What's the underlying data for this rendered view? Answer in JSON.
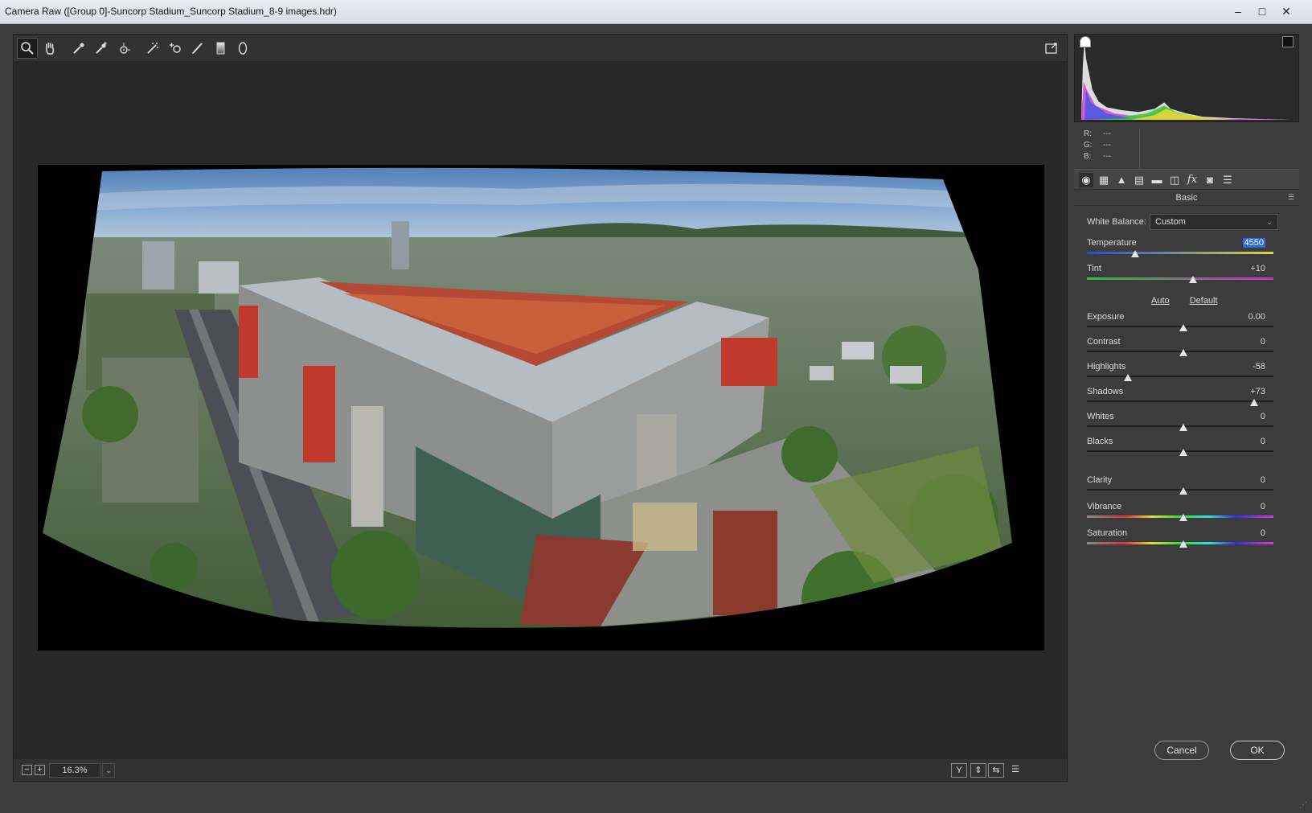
{
  "window": {
    "title": "Camera Raw ([Group 0]-Suncorp Stadium_Suncorp Stadium_8-9 images.hdr)",
    "minimize": "–",
    "maximize": "□",
    "close": "✕"
  },
  "toolbar": {
    "tools": [
      {
        "name": "zoom-tool",
        "icon": "magnifier"
      },
      {
        "name": "hand-tool",
        "icon": "hand"
      },
      {
        "name": "white-balance-tool",
        "icon": "eyedropper"
      },
      {
        "name": "color-sampler-tool",
        "icon": "eyedropper-plus"
      },
      {
        "name": "targeted-adjustment-tool",
        "icon": "target"
      },
      {
        "name": "straighten-tool",
        "icon": "spot"
      },
      {
        "name": "spot-removal-tool",
        "icon": "heal"
      },
      {
        "name": "adjustment-brush-tool",
        "icon": "brush"
      },
      {
        "name": "graduated-filter-tool",
        "icon": "gradient"
      },
      {
        "name": "radial-filter-tool",
        "icon": "ellipse"
      }
    ],
    "fullscreen_icon": "fullscreen"
  },
  "canvas": {
    "zoom": "16.3%",
    "zoom_out": "−",
    "zoom_in": "+",
    "zoom_caret": "⌄",
    "view_buttons": [
      "Y",
      "⇕",
      "⇆",
      "☰"
    ]
  },
  "histogram": {
    "r_label": "R:",
    "r_value": "---",
    "g_label": "G:",
    "g_value": "---",
    "b_label": "B:",
    "b_value": "---"
  },
  "panel": {
    "tabs": [
      "basic",
      "tone-curve",
      "detail",
      "hsl",
      "split-toning",
      "lens-corrections",
      "effects",
      "camera-calibration",
      "presets"
    ],
    "section_title": "Basic",
    "white_balance_label": "White Balance:",
    "white_balance_value": "Custom",
    "auto_label": "Auto",
    "default_label": "Default",
    "sliders": {
      "temperature": {
        "label": "Temperature",
        "value": "4550"
      },
      "tint": {
        "label": "Tint",
        "value": "+10"
      },
      "exposure": {
        "label": "Exposure",
        "value": "0.00"
      },
      "contrast": {
        "label": "Contrast",
        "value": "0"
      },
      "highlights": {
        "label": "Highlights",
        "value": "-58"
      },
      "shadows": {
        "label": "Shadows",
        "value": "+73"
      },
      "whites": {
        "label": "Whites",
        "value": "0"
      },
      "blacks": {
        "label": "Blacks",
        "value": "0"
      },
      "clarity": {
        "label": "Clarity",
        "value": "0"
      },
      "vibrance": {
        "label": "Vibrance",
        "value": "0"
      },
      "saturation": {
        "label": "Saturation",
        "value": "0"
      }
    }
  },
  "buttons": {
    "cancel": "Cancel",
    "ok": "OK"
  }
}
